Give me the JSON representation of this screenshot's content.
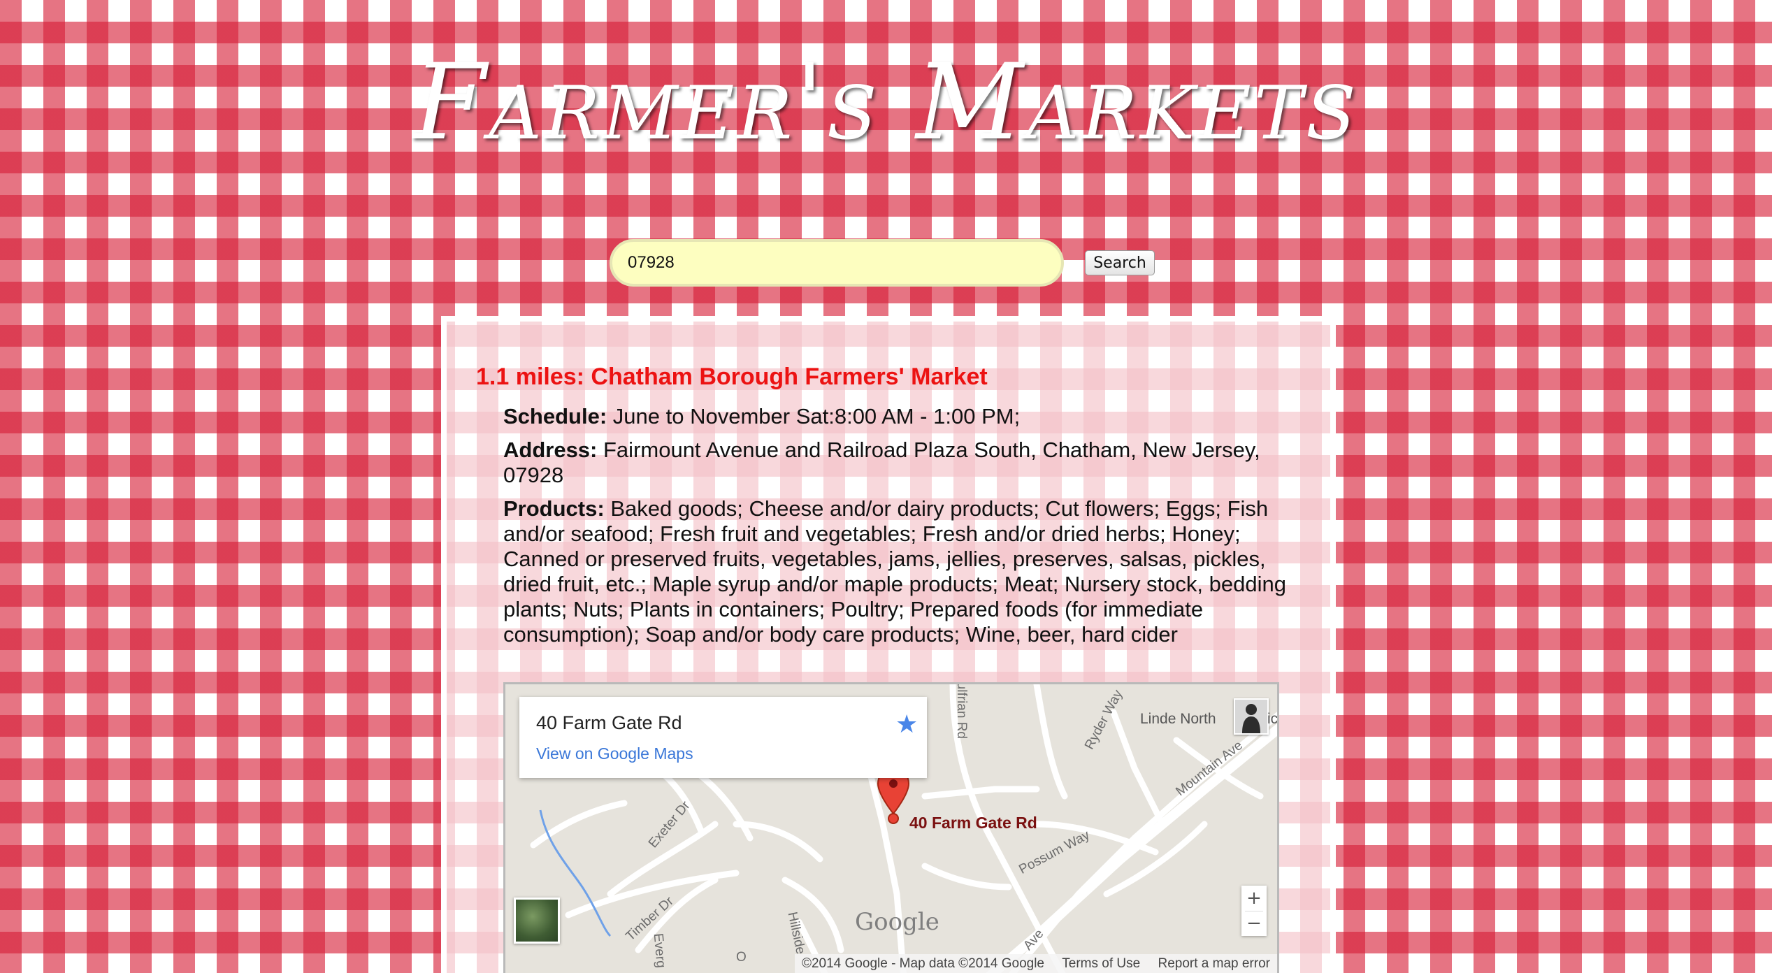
{
  "header": {
    "title": "Farmer's Markets"
  },
  "search": {
    "value": "07928",
    "button_label": "Search"
  },
  "market": {
    "title": "1.1 miles: Chatham Borough Farmers' Market",
    "schedule_label": "Schedule:",
    "schedule": "June to November Sat:8:00 AM - 1:00 PM;",
    "address_label": "Address:",
    "address": "Fairmount Avenue and Railroad Plaza South, Chatham, New Jersey, 07928",
    "products_label": "Products:",
    "products": "Baked goods; Cheese and/or dairy products; Cut flowers; Eggs; Fish and/or seafood; Fresh fruit and vegetables; Fresh and/or dried herbs; Honey; Canned or preserved fruits, vegetables, jams, jellies, preserves, salsas, pickles, dried fruit, etc.; Maple syrup and/or maple products; Meat; Nursery stock, bedding plants; Nuts; Plants in containers; Poultry; Prepared foods (for immediate consumption); Soap and/or body care products; Wine, beer, hard cider"
  },
  "map": {
    "info_address": "40 Farm Gate Rd",
    "info_link": "View on Google Maps",
    "star_icon": "star-icon",
    "marker_label": "40 Farm Gate Rd",
    "poi_label": "Linde North",
    "poi_label_cut": "ic",
    "streets": {
      "sulfrian": "Sulfrian Rd",
      "ryder": "Ryder Way",
      "mountain": "Mountain Ave",
      "exeter": "Exeter Dr",
      "possum": "Possum Way",
      "timber": "Timber Dr",
      "hillside": "Hillside",
      "everg": "Everg",
      "ave": "Ave",
      "o": "O"
    },
    "logo": "Google",
    "zoom_in": "+",
    "zoom_out": "−",
    "footer": {
      "copyright": "©2014 Google - Map data ©2014 Google",
      "terms": "Terms of Use",
      "report": "Report a map error"
    }
  },
  "colors": {
    "gingham_red": "#d61e37",
    "market_title": "#ec1212",
    "search_bg": "#fdfec0",
    "link": "#3a77d8"
  }
}
